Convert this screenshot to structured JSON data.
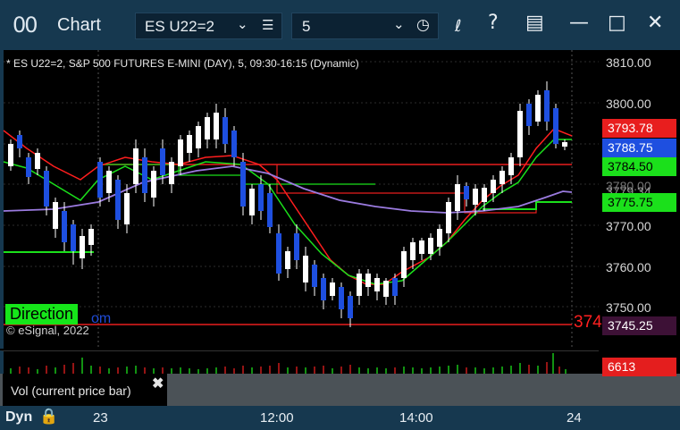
{
  "titlebar": {
    "app_title": "Chart",
    "app_icon": "00",
    "symbol": "ES U22=2",
    "interval": "5",
    "icons": [
      "chevron-down-icon",
      "menu-icon",
      "chevron-down-icon",
      "clock-icon",
      "draw-icon",
      "help-icon",
      "layout-icon",
      "minimize-icon",
      "maximize-icon",
      "close-icon"
    ]
  },
  "chart": {
    "header": "* ES U22=2, S&P 500 FUTURES E-MINI (DAY), 5, 09:30-16:15 (Dynamic)",
    "direction_label": "Direction",
    "overlay_text": "om",
    "copyright": "© eSignal, 2022",
    "cutoff_price": "374",
    "axis_labels": [
      "3810.00",
      "3800.00",
      "3770.00",
      "3760.00",
      "3750.00"
    ],
    "hidden_labels": [
      "3780.00",
      "3779.34"
    ],
    "price_tags": [
      {
        "value": "3793.78",
        "color": "#e81e1e"
      },
      {
        "value": "3788.75",
        "color": "#1e4fe0"
      },
      {
        "value": "3784.50",
        "color": "#1be01b"
      },
      {
        "value": "3775.75",
        "color": "#1be01b"
      },
      {
        "value": "3745.25",
        "color": "#3d1136"
      }
    ]
  },
  "volume": {
    "label": "Vol (current price bar)",
    "close_icon": "close-icon",
    "value": "6613"
  },
  "bottombar": {
    "mode": "Dyn",
    "lock_icon": "lock-icon",
    "time_labels": [
      "23",
      "12:00",
      "14:00",
      "24"
    ]
  }
}
